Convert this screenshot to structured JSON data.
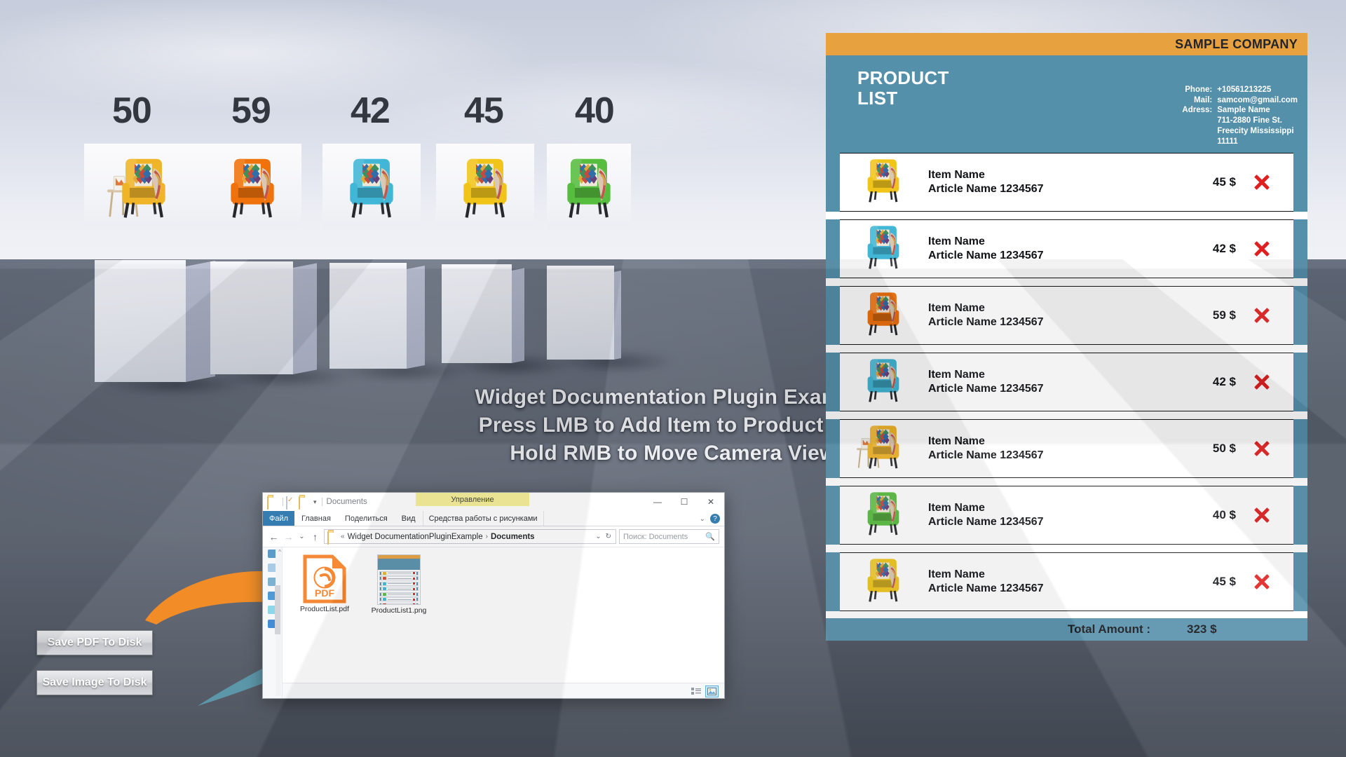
{
  "scene": {
    "prices": [
      "50",
      "59",
      "42",
      "45",
      "40"
    ],
    "chair_colors": [
      "#f0b429",
      "#f0720c",
      "#41b6d6",
      "#f0c419",
      "#57bd3f"
    ],
    "instructions": [
      "Widget Documentation Plugin Example",
      "Press LMB to Add Item to Product List",
      "Hold RMB to Move Camera View"
    ],
    "buttons": {
      "save_pdf": "Save PDF To Disk",
      "save_image": "Save Image To Disk"
    },
    "arrows": {
      "pdf_arrow_color": "#f0800f",
      "image_arrow_color": "#4a8ca0"
    }
  },
  "explorer": {
    "title": "Documents",
    "context_tab": "Управление",
    "quick_access": [
      "folder-icon",
      "properties-icon",
      "new-folder-icon",
      "dropdown-caret-icon"
    ],
    "window_controls": {
      "minimize": "—",
      "maximize": "☐",
      "close": "✕",
      "collapse_ribbon": "⌄",
      "help": "?"
    },
    "ribbon_tabs": [
      "Файл",
      "Главная",
      "Поделиться",
      "Вид"
    ],
    "ribbon_context_tab": "Средства работы с рисунками",
    "nav": {
      "back": "←",
      "forward": "→",
      "recent": "⌄",
      "up": "↑"
    },
    "address": {
      "prefix": "«",
      "segments": [
        "Widget DocumentationPluginExample",
        "Documents"
      ],
      "separator": "›",
      "dropdown": "⌄",
      "refresh": "↻"
    },
    "search": {
      "placeholder": "Поиск: Documents",
      "icon": "search-icon"
    },
    "files": [
      {
        "name": "ProductList.pdf",
        "type": "pdf",
        "label": "PDF"
      },
      {
        "name": "ProductList1.png",
        "type": "png"
      }
    ],
    "status_views": [
      "details-view",
      "large-icons-view"
    ],
    "active_view": "large-icons-view"
  },
  "product_list": {
    "company": "SAMPLE COMPANY",
    "title_line1": "PRODUCT",
    "title_line2": "LIST",
    "contact_labels": [
      "Phone:",
      "Mail:",
      "Adress:"
    ],
    "contact_values": [
      "+10561213225",
      "samcom@gmail.com",
      "Sample Name"
    ],
    "address_lines": [
      "711-2880 Fine St.",
      "Freecity Mississippi",
      "11111"
    ],
    "colors": {
      "accent_orange": "#e8a13f",
      "panel_blue": "#5590ab",
      "delete_red": "#e02020"
    },
    "rows": [
      {
        "item_name": "Item Name",
        "article": "Article Name 1234567",
        "price": "45 $",
        "color": "#f0c419",
        "variant": "plain"
      },
      {
        "item_name": "Item Name",
        "article": "Article Name 1234567",
        "price": "42 $",
        "color": "#41b6d6",
        "variant": "plain"
      },
      {
        "item_name": "Item Name",
        "article": "Article Name 1234567",
        "price": "59 $",
        "color": "#f0720c",
        "variant": "plain"
      },
      {
        "item_name": "Item Name",
        "article": "Article Name 1234567",
        "price": "42 $",
        "color": "#41b6d6",
        "variant": "plain"
      },
      {
        "item_name": "Item Name",
        "article": "Article Name 1234567",
        "price": "50 $",
        "color": "#f0b429",
        "variant": "with-table"
      },
      {
        "item_name": "Item Name",
        "article": "Article Name 1234567",
        "price": "40 $",
        "color": "#57bd3f",
        "variant": "plain"
      },
      {
        "item_name": "Item Name",
        "article": "Article Name 1234567",
        "price": "45 $",
        "color": "#f0c419",
        "variant": "plain"
      }
    ],
    "total_label": "Total Amount :",
    "total_value": "323 $"
  }
}
